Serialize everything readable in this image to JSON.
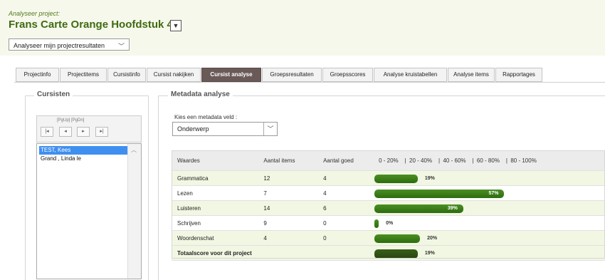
{
  "header": {
    "subtitle": "Analyseer project:",
    "title": "Frans Carte Orange Hoofdstuk 4",
    "action_select": "Analyseer mijn projectresultaten"
  },
  "tabs": [
    {
      "label": "Projectinfo",
      "active": false
    },
    {
      "label": "Projectitems",
      "active": false
    },
    {
      "label": "Cursistinfo",
      "active": false
    },
    {
      "label": "Cursist nakijken",
      "active": false
    },
    {
      "label": "Cursist analyse",
      "active": true
    },
    {
      "label": "Groepsresultaten",
      "active": false
    },
    {
      "label": "Groepsscores",
      "active": false
    },
    {
      "label": "Analyse kruistabellen",
      "active": false
    },
    {
      "label": "Analyse items",
      "active": false
    },
    {
      "label": "Rapportages",
      "active": false
    }
  ],
  "students_panel": {
    "legend": "Cursisten",
    "pager_label": "[PgUp] [PgDn]",
    "students": [
      {
        "name": "TEST, Kees",
        "selected": true
      },
      {
        "name": "Grand , Linda le",
        "selected": false
      }
    ]
  },
  "metadata_panel": {
    "legend": "Metadata analyse",
    "field_label": "Kies een metadata veld :",
    "field_value": "Onderwerp",
    "columns": [
      "Waardes",
      "Aantal items",
      "Aantal goed",
      "0 - 20%    |  20 - 40%    |  40 - 60%    |  60 - 80%    |  80 - 100%"
    ],
    "rows": [
      {
        "value": "Grammatica",
        "items": "12",
        "good": "4",
        "percent": 19,
        "percent_label": "19%"
      },
      {
        "value": "Lezen",
        "items": "7",
        "good": "4",
        "percent": 57,
        "percent_label": "57%"
      },
      {
        "value": "Luisteren",
        "items": "14",
        "good": "6",
        "percent": 39,
        "percent_label": "39%"
      },
      {
        "value": "Schrijven",
        "items": "9",
        "good": "0",
        "percent": 0,
        "percent_label": "0%"
      },
      {
        "value": "Woordenschat",
        "items": "4",
        "good": "0",
        "percent": 20,
        "percent_label": "20%"
      }
    ],
    "total": {
      "value": "Totaalscore voor dit project",
      "percent": 19,
      "percent_label": "19%"
    }
  },
  "icons": {
    "filter": "filter-icon",
    "first": "first-page-icon",
    "prev": "previous-page-icon",
    "next": "next-page-icon",
    "last": "last-page-icon",
    "dropdown": "chevron-down-icon"
  },
  "colors": {
    "title": "#3f6b12",
    "bar": "#3a7a18",
    "active_tab": "#6a5a57",
    "selected_row": "#3f8ff0"
  }
}
